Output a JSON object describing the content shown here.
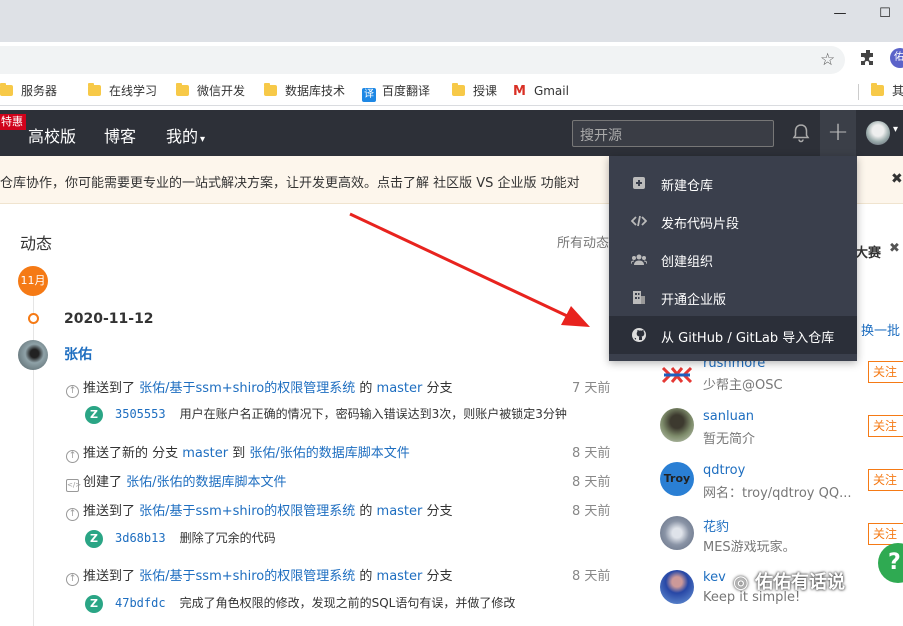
{
  "window": {
    "minimize_icon": "minimize-icon",
    "maximize_icon": "maximize-icon"
  },
  "browser": {
    "profile_initial": "佑",
    "bookmarks": [
      {
        "label": "服务器",
        "icon": "folder-icon"
      },
      {
        "label": "在线学习",
        "icon": "folder-icon"
      },
      {
        "label": "微信开发",
        "icon": "folder-icon"
      },
      {
        "label": "数据库技术",
        "icon": "folder-icon"
      },
      {
        "label": "百度翻译",
        "icon": "translate-icon",
        "icon_text": "译"
      },
      {
        "label": "授课",
        "icon": "folder-icon"
      },
      {
        "label": "Gmail",
        "icon": "gmail-icon",
        "icon_text": "M"
      },
      {
        "label": "其",
        "icon": "folder-icon"
      }
    ]
  },
  "nav": {
    "promo_badge": "特惠",
    "links": [
      "高校版",
      "博客",
      "我的"
    ],
    "dropdown_caret": "▾",
    "search_placeholder": "搜开源",
    "plus_label": "+"
  },
  "notice": {
    "text": "仓库协作，你可能需要更专业的一站式解决方案，让开发更高效。点击了解 社区版 VS 企业版 功能对",
    "close": "✖"
  },
  "activity": {
    "title": "动态",
    "all_link": "所有动态",
    "month_badge": "11月",
    "date": "2020-11-12",
    "user": "张佑",
    "items": [
      {
        "icon": "push-icon",
        "prefix": "推送到了 ",
        "repo": "张佑/基于ssm+shiro的权限管理系统",
        "mid": " 的 ",
        "branch": "master",
        "suffix": " 分支",
        "time": "7 天前",
        "commit": {
          "badge": "Z",
          "sha": "3505553",
          "message": "用户在账户名正确的情况下，密码输入错误达到3次，则账户被锁定3分钟"
        }
      },
      {
        "icon": "push-icon",
        "prefix": "推送了新的 分支 ",
        "branch": "master",
        "mid": " 到 ",
        "repo": "张佑/张佑的数据库脚本文件",
        "time": "8 天前"
      },
      {
        "icon": "file-code-icon",
        "prefix": "创建了 ",
        "repo": "张佑/张佑的数据库脚本文件",
        "time": "8 天前"
      },
      {
        "icon": "push-icon",
        "prefix": "推送到了 ",
        "repo": "张佑/基于ssm+shiro的权限管理系统",
        "mid": " 的 ",
        "branch": "master",
        "suffix": " 分支",
        "time": "8 天前",
        "commit": {
          "badge": "Z",
          "sha": "3d68b13",
          "message": "删除了冗余的代码"
        }
      },
      {
        "icon": "push-icon",
        "prefix": "推送到了 ",
        "repo": "张佑/基于ssm+shiro的权限管理系统",
        "mid": " 的 ",
        "branch": "master",
        "suffix": " 分支",
        "time": "8 天前",
        "commit": {
          "badge": "Z",
          "sha": "47bdfdc",
          "message": "完成了角色权限的修改，发现之前的SQL语句有误，并做了修改"
        }
      }
    ]
  },
  "dropdown": {
    "items": [
      {
        "label": "新建仓库",
        "icon": "new-repo-icon"
      },
      {
        "label": "发布代码片段",
        "icon": "code-snippet-icon"
      },
      {
        "label": "创建组织",
        "icon": "organization-icon"
      },
      {
        "label": "开通企业版",
        "icon": "enterprise-icon"
      },
      {
        "label": "从 GitHub / GitLab 导入仓库",
        "icon": "github-icon"
      }
    ]
  },
  "sidebar": {
    "contest": "大赛",
    "contest_close": "✖",
    "refresh": "换一批",
    "follow_label": "关注",
    "users": [
      {
        "name": "rushmore",
        "desc": "少帮主@OSC"
      },
      {
        "name": "sanluan",
        "desc": "暂无简介"
      },
      {
        "name": "qdtroy",
        "desc": "网名：troy/qdtroy QQ...",
        "avatar_text": "Troy"
      },
      {
        "name": "花豹",
        "desc": "MES游戏玩家。"
      },
      {
        "name": "kev",
        "desc": "Keep it simple!"
      }
    ]
  },
  "watermark": "佑佑有话说"
}
